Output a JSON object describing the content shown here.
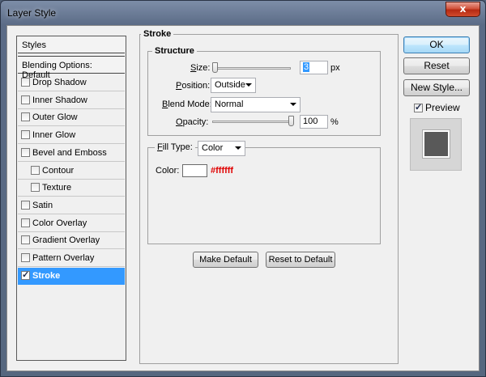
{
  "window": {
    "title": "Layer Style",
    "close_glyph": "x"
  },
  "sidebar": {
    "header": "Styles",
    "blending": "Blending Options: Default",
    "items": [
      {
        "label": "Drop Shadow",
        "checked": false,
        "sub": false,
        "selected": false
      },
      {
        "label": "Inner Shadow",
        "checked": false,
        "sub": false,
        "selected": false
      },
      {
        "label": "Outer Glow",
        "checked": false,
        "sub": false,
        "selected": false
      },
      {
        "label": "Inner Glow",
        "checked": false,
        "sub": false,
        "selected": false
      },
      {
        "label": "Bevel and Emboss",
        "checked": false,
        "sub": false,
        "selected": false
      },
      {
        "label": "Contour",
        "checked": false,
        "sub": true,
        "selected": false
      },
      {
        "label": "Texture",
        "checked": false,
        "sub": true,
        "selected": false
      },
      {
        "label": "Satin",
        "checked": false,
        "sub": false,
        "selected": false
      },
      {
        "label": "Color Overlay",
        "checked": false,
        "sub": false,
        "selected": false
      },
      {
        "label": "Gradient Overlay",
        "checked": false,
        "sub": false,
        "selected": false
      },
      {
        "label": "Pattern Overlay",
        "checked": false,
        "sub": false,
        "selected": false
      },
      {
        "label": "Stroke",
        "checked": true,
        "sub": false,
        "selected": true
      }
    ]
  },
  "stroke": {
    "section_title": "Stroke",
    "structure_title": "Structure",
    "size_label": "Size:",
    "size_value": "3",
    "size_unit": "px",
    "position_label": "Position:",
    "position_value": "Outside",
    "blend_label": "Blend Mode:",
    "blend_value": "Normal",
    "opacity_label": "Opacity:",
    "opacity_value": "100",
    "opacity_unit": "%",
    "fill_type_label": "Fill Type:",
    "fill_type_value": "Color",
    "color_label": "Color:",
    "color_hex": "#ffffff",
    "make_default": "Make Default",
    "reset_default": "Reset to Default"
  },
  "actions": {
    "ok": "OK",
    "reset": "Reset",
    "new_style": "New Style...",
    "preview_label": "Preview",
    "preview_checked": true
  },
  "colors": {
    "selection": "#3399ff",
    "hex_text": "#e00000"
  }
}
